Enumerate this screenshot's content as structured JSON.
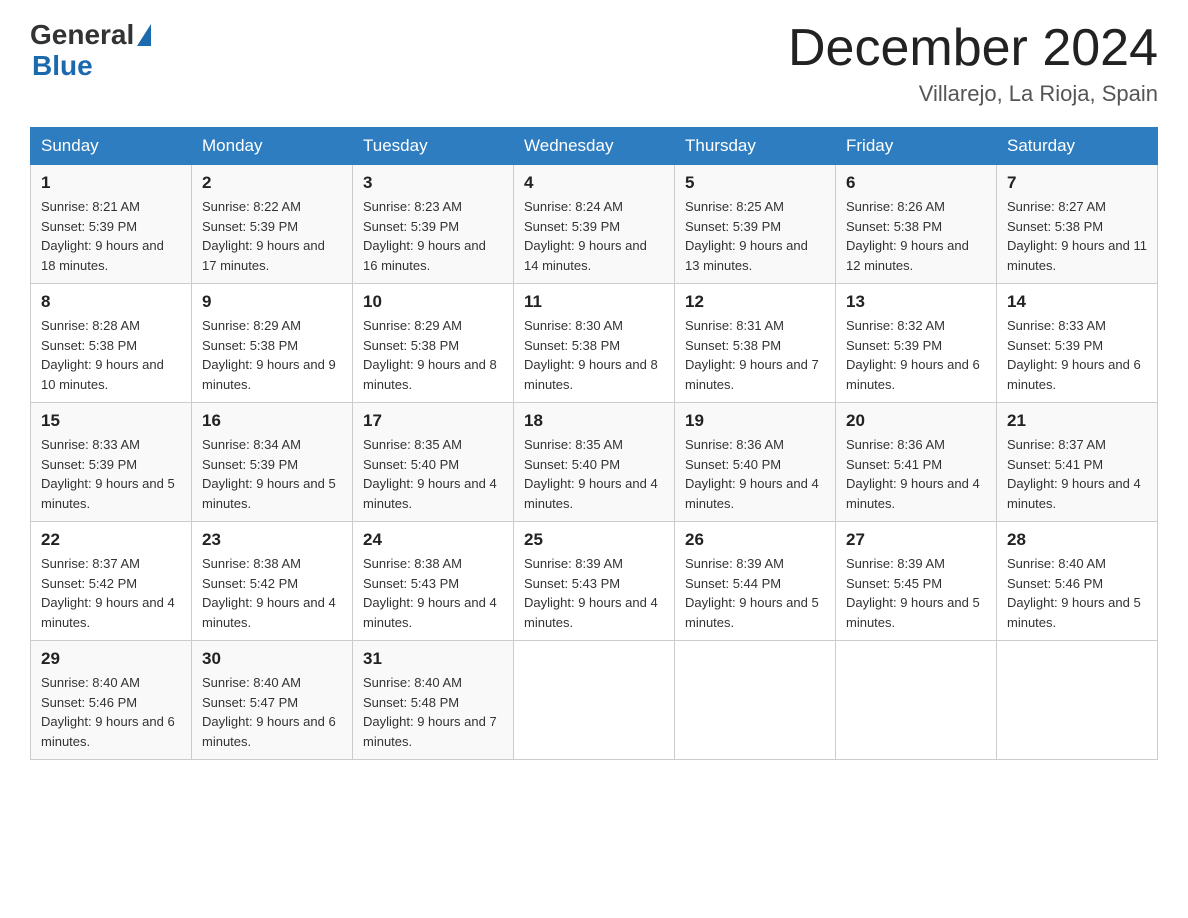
{
  "header": {
    "logo_general": "General",
    "logo_blue": "Blue",
    "month_year": "December 2024",
    "location": "Villarejo, La Rioja, Spain"
  },
  "days_of_week": [
    "Sunday",
    "Monday",
    "Tuesday",
    "Wednesday",
    "Thursday",
    "Friday",
    "Saturday"
  ],
  "weeks": [
    [
      {
        "day": "1",
        "sunrise": "8:21 AM",
        "sunset": "5:39 PM",
        "daylight": "9 hours and 18 minutes."
      },
      {
        "day": "2",
        "sunrise": "8:22 AM",
        "sunset": "5:39 PM",
        "daylight": "9 hours and 17 minutes."
      },
      {
        "day": "3",
        "sunrise": "8:23 AM",
        "sunset": "5:39 PM",
        "daylight": "9 hours and 16 minutes."
      },
      {
        "day": "4",
        "sunrise": "8:24 AM",
        "sunset": "5:39 PM",
        "daylight": "9 hours and 14 minutes."
      },
      {
        "day": "5",
        "sunrise": "8:25 AM",
        "sunset": "5:39 PM",
        "daylight": "9 hours and 13 minutes."
      },
      {
        "day": "6",
        "sunrise": "8:26 AM",
        "sunset": "5:38 PM",
        "daylight": "9 hours and 12 minutes."
      },
      {
        "day": "7",
        "sunrise": "8:27 AM",
        "sunset": "5:38 PM",
        "daylight": "9 hours and 11 minutes."
      }
    ],
    [
      {
        "day": "8",
        "sunrise": "8:28 AM",
        "sunset": "5:38 PM",
        "daylight": "9 hours and 10 minutes."
      },
      {
        "day": "9",
        "sunrise": "8:29 AM",
        "sunset": "5:38 PM",
        "daylight": "9 hours and 9 minutes."
      },
      {
        "day": "10",
        "sunrise": "8:29 AM",
        "sunset": "5:38 PM",
        "daylight": "9 hours and 8 minutes."
      },
      {
        "day": "11",
        "sunrise": "8:30 AM",
        "sunset": "5:38 PM",
        "daylight": "9 hours and 8 minutes."
      },
      {
        "day": "12",
        "sunrise": "8:31 AM",
        "sunset": "5:38 PM",
        "daylight": "9 hours and 7 minutes."
      },
      {
        "day": "13",
        "sunrise": "8:32 AM",
        "sunset": "5:39 PM",
        "daylight": "9 hours and 6 minutes."
      },
      {
        "day": "14",
        "sunrise": "8:33 AM",
        "sunset": "5:39 PM",
        "daylight": "9 hours and 6 minutes."
      }
    ],
    [
      {
        "day": "15",
        "sunrise": "8:33 AM",
        "sunset": "5:39 PM",
        "daylight": "9 hours and 5 minutes."
      },
      {
        "day": "16",
        "sunrise": "8:34 AM",
        "sunset": "5:39 PM",
        "daylight": "9 hours and 5 minutes."
      },
      {
        "day": "17",
        "sunrise": "8:35 AM",
        "sunset": "5:40 PM",
        "daylight": "9 hours and 4 minutes."
      },
      {
        "day": "18",
        "sunrise": "8:35 AM",
        "sunset": "5:40 PM",
        "daylight": "9 hours and 4 minutes."
      },
      {
        "day": "19",
        "sunrise": "8:36 AM",
        "sunset": "5:40 PM",
        "daylight": "9 hours and 4 minutes."
      },
      {
        "day": "20",
        "sunrise": "8:36 AM",
        "sunset": "5:41 PM",
        "daylight": "9 hours and 4 minutes."
      },
      {
        "day": "21",
        "sunrise": "8:37 AM",
        "sunset": "5:41 PM",
        "daylight": "9 hours and 4 minutes."
      }
    ],
    [
      {
        "day": "22",
        "sunrise": "8:37 AM",
        "sunset": "5:42 PM",
        "daylight": "9 hours and 4 minutes."
      },
      {
        "day": "23",
        "sunrise": "8:38 AM",
        "sunset": "5:42 PM",
        "daylight": "9 hours and 4 minutes."
      },
      {
        "day": "24",
        "sunrise": "8:38 AM",
        "sunset": "5:43 PM",
        "daylight": "9 hours and 4 minutes."
      },
      {
        "day": "25",
        "sunrise": "8:39 AM",
        "sunset": "5:43 PM",
        "daylight": "9 hours and 4 minutes."
      },
      {
        "day": "26",
        "sunrise": "8:39 AM",
        "sunset": "5:44 PM",
        "daylight": "9 hours and 5 minutes."
      },
      {
        "day": "27",
        "sunrise": "8:39 AM",
        "sunset": "5:45 PM",
        "daylight": "9 hours and 5 minutes."
      },
      {
        "day": "28",
        "sunrise": "8:40 AM",
        "sunset": "5:46 PM",
        "daylight": "9 hours and 5 minutes."
      }
    ],
    [
      {
        "day": "29",
        "sunrise": "8:40 AM",
        "sunset": "5:46 PM",
        "daylight": "9 hours and 6 minutes."
      },
      {
        "day": "30",
        "sunrise": "8:40 AM",
        "sunset": "5:47 PM",
        "daylight": "9 hours and 6 minutes."
      },
      {
        "day": "31",
        "sunrise": "8:40 AM",
        "sunset": "5:48 PM",
        "daylight": "9 hours and 7 minutes."
      },
      null,
      null,
      null,
      null
    ]
  ]
}
